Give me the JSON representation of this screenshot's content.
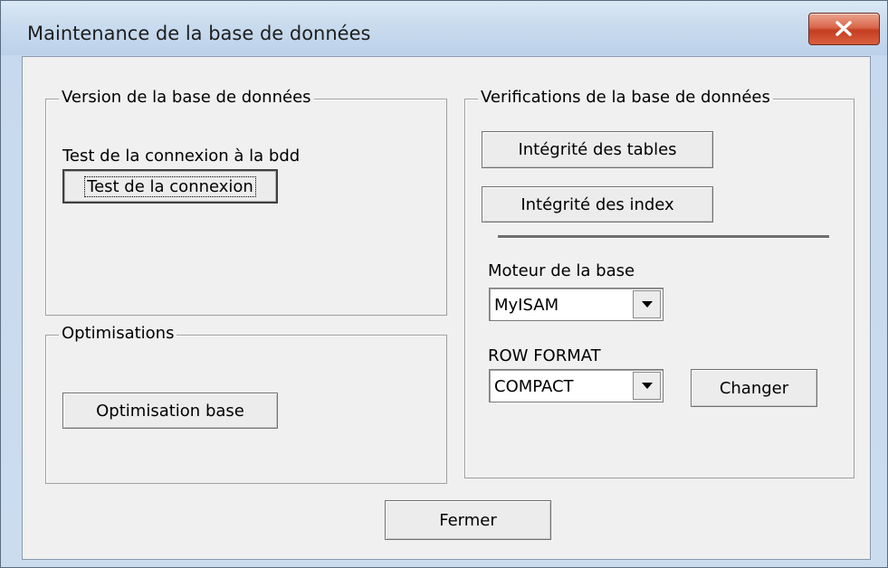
{
  "window": {
    "title": "Maintenance de la base de données",
    "close_icon": "close-icon"
  },
  "version_group": {
    "legend": "Version de la base de données",
    "label": "Test de la connexion à la bdd",
    "test_button": "Test de la connexion"
  },
  "optim_group": {
    "legend": "Optimisations",
    "optim_button": "Optimisation base"
  },
  "verif_group": {
    "legend": "Verifications de la base de données",
    "tables_button": "Intégrité des tables",
    "index_button": "Intégrité des index",
    "engine_label": "Moteur de la base",
    "engine_value": "MyISAM",
    "row_format_label": "ROW FORMAT",
    "row_format_value": "COMPACT",
    "change_button": "Changer"
  },
  "footer": {
    "close_button": "Fermer"
  },
  "colors": {
    "dialog_bg": "#f0f0f0",
    "close_red": "#c53d21",
    "frame_blue": "#c7d9ee"
  }
}
